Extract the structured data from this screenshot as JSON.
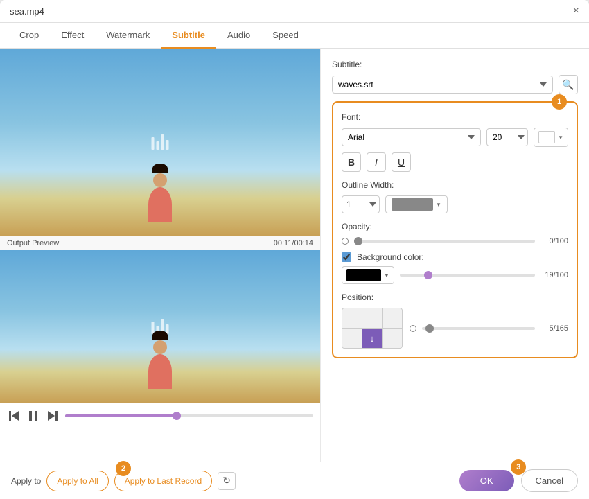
{
  "window": {
    "title": "sea.mp4",
    "close_label": "×"
  },
  "tabs": [
    {
      "label": "Crop",
      "active": false
    },
    {
      "label": "Effect",
      "active": false
    },
    {
      "label": "Watermark",
      "active": false
    },
    {
      "label": "Subtitle",
      "active": true
    },
    {
      "label": "Audio",
      "active": false
    },
    {
      "label": "Speed",
      "active": false
    }
  ],
  "preview": {
    "output_label": "Output Preview",
    "timestamp": "00:11/00:14",
    "subtitle_text": "waves sit"
  },
  "playback": {
    "prev_icon": "⏮",
    "play_icon": "⏸",
    "next_icon": "⏭",
    "progress_pct": 45
  },
  "right_panel": {
    "subtitle_label": "Subtitle:",
    "subtitle_file": "waves.srt",
    "search_icon": "🔍",
    "step1_badge": "1",
    "font_label": "Font:",
    "font_value": "Arial",
    "font_size": "20",
    "bold_label": "B",
    "italic_label": "I",
    "underline_label": "U",
    "outline_label": "Outline Width:",
    "outline_value": "1",
    "opacity_label": "Opacity:",
    "opacity_value": "0/100",
    "bg_color_label": "Background color:",
    "bg_value": "19/100",
    "position_label": "Position:",
    "position_value": "5/165"
  },
  "footer": {
    "apply_to_label": "Apply to",
    "apply_to_all_label": "Apply to All",
    "apply_to_last_label": "Apply to Last Record",
    "step2_badge": "2",
    "step3_badge": "3",
    "ok_label": "OK",
    "cancel_label": "Cancel"
  }
}
